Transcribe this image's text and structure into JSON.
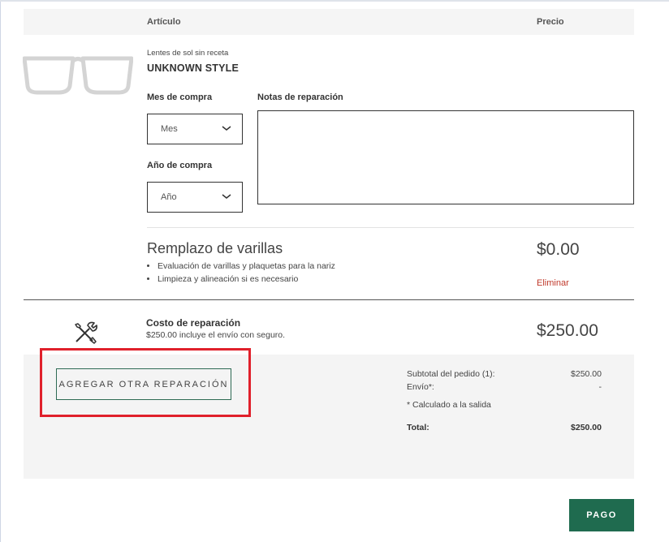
{
  "table_header": {
    "item": "Artículo",
    "price": "Precio"
  },
  "product": {
    "category": "Lentes de sol sin receta",
    "style": "UNKNOWN STYLE",
    "image_icon": "eyeglasses-icon"
  },
  "form": {
    "purchase_month_label": "Mes de compra",
    "purchase_month_value": "Mes",
    "purchase_year_label": "Año de compra",
    "purchase_year_value": "Año",
    "notes_label": "Notas de reparación",
    "notes_value": ""
  },
  "service": {
    "title": "Remplazo de varillas",
    "bullets": [
      "Evaluación de varillas y plaquetas para la nariz",
      "Limpieza y alineación si es necesario"
    ],
    "price": "$0.00",
    "remove_label": "Eliminar"
  },
  "repair_cost": {
    "icon": "tools-icon",
    "title": "Costo de reparación",
    "description": "$250.00  incluye el envío con seguro.",
    "price": "$250.00"
  },
  "add_repair_label": "AGREGAR OTRA REPARACIÓN",
  "summary": {
    "subtotal_label": "Subtotal del pedido (1):",
    "subtotal_value": "$250.00",
    "shipping_label": "Envío*:",
    "shipping_value": "-",
    "note": "* Calculado a la salida",
    "total_label": "Total:",
    "total_value": "$250.00"
  },
  "checkout_label": "PAGO",
  "colors": {
    "accent_green": "#1f6b4f",
    "remove_red": "#c0392b",
    "highlight_red": "#e0202b"
  }
}
